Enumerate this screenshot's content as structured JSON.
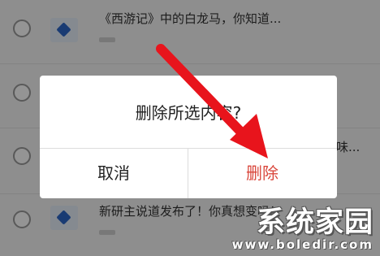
{
  "list": {
    "rows": [
      {
        "title": "《西游记》中的白龙马，你知道..."
      },
      {
        "title": ""
      },
      {
        "title": ""
      },
      {
        "title": "新研主说道发布了！你真想变吗！"
      }
    ],
    "row3_tail": "味..."
  },
  "dialog": {
    "message": "删除所选内容?",
    "cancel_label": "取消",
    "delete_label": "删除"
  },
  "watermark": {
    "name": "系统家园",
    "url": "www.boledir.com"
  },
  "colors": {
    "delete": "#d9463b",
    "arrow": "#e8141c",
    "overlay": "rgba(0,0,0,0.42)"
  }
}
